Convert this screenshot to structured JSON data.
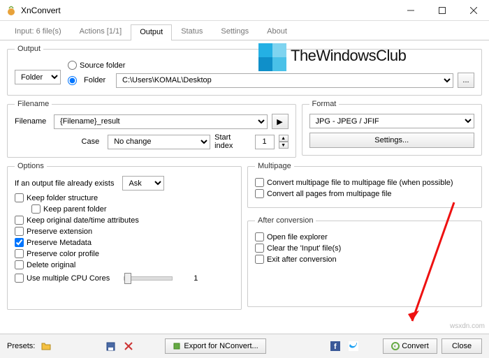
{
  "title": "XnConvert",
  "tabs": [
    "Input: 6 file(s)",
    "Actions [1/1]",
    "Output",
    "Status",
    "Settings",
    "About"
  ],
  "active_tab": 2,
  "output": {
    "legend": "Output",
    "folder_btn": "Folder",
    "opt_source": "Source folder",
    "opt_folder": "Folder",
    "path": "C:\\Users\\KOMAL\\Desktop"
  },
  "filename": {
    "legend": "Filename",
    "label": "Filename",
    "value": "{Filename}_result",
    "case_label": "Case",
    "case_value": "No change",
    "start_label": "Start index",
    "start_value": "1"
  },
  "format": {
    "legend": "Format",
    "value": "JPG - JPEG / JFIF",
    "settings": "Settings..."
  },
  "options": {
    "legend": "Options",
    "exists_label": "If an output file already exists",
    "exists_value": "Ask",
    "keep_folder": "Keep folder structure",
    "keep_parent": "Keep parent folder",
    "keep_date": "Keep original date/time attributes",
    "preserve_ext": "Preserve extension",
    "preserve_meta": "Preserve Metadata",
    "preserve_color": "Preserve color profile",
    "delete_orig": "Delete original",
    "cpu_cores": "Use multiple CPU Cores",
    "cpu_value": "1"
  },
  "multipage": {
    "legend": "Multipage",
    "convert": "Convert multipage file to multipage file (when possible)",
    "all_pages": "Convert all pages from multipage file"
  },
  "after": {
    "legend": "After conversion",
    "open_explorer": "Open file explorer",
    "clear_input": "Clear the 'Input' file(s)",
    "exit": "Exit after conversion"
  },
  "footer": {
    "presets": "Presets:",
    "export": "Export for NConvert...",
    "convert": "Convert",
    "close": "Close"
  },
  "overlay": "TheWindowsClub",
  "watermark": "wsxdn.com"
}
